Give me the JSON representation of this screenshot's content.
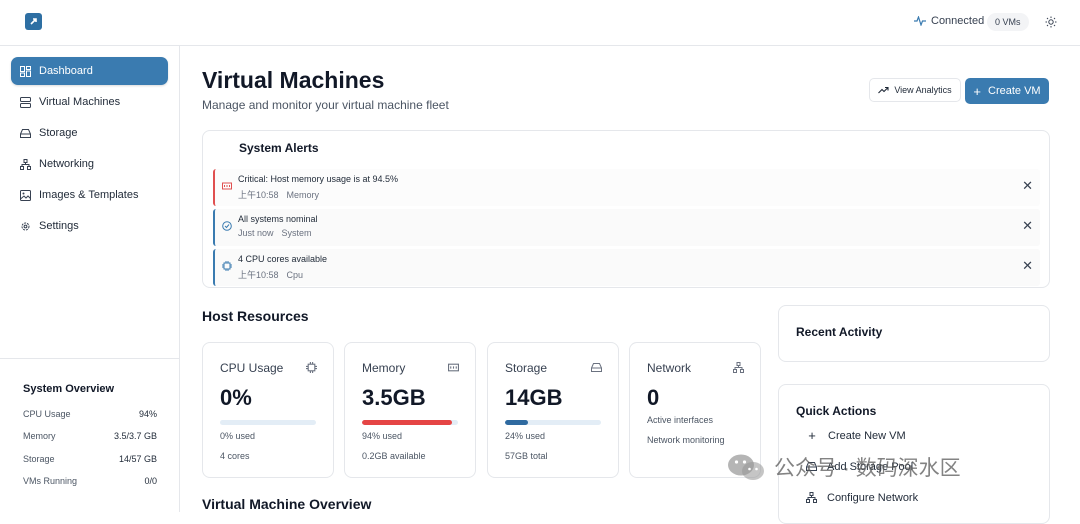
{
  "topbar": {
    "connection_label": "Connected",
    "vms_count": "0 VMs"
  },
  "sidebar": {
    "items": [
      {
        "label": "Dashboard",
        "icon": "dashboard-icon",
        "active": true
      },
      {
        "label": "Virtual Machines",
        "icon": "server-icon"
      },
      {
        "label": "Storage",
        "icon": "hard-drive-icon"
      },
      {
        "label": "Networking",
        "icon": "network-icon"
      },
      {
        "label": "Images & Templates",
        "icon": "image-icon"
      },
      {
        "label": "Settings",
        "icon": "gear-icon"
      }
    ],
    "overview": {
      "title": "System Overview",
      "rows": [
        {
          "label": "CPU Usage",
          "value": "94%"
        },
        {
          "label": "Memory",
          "value": "3.5/3.7 GB"
        },
        {
          "label": "Storage",
          "value": "14/57 GB"
        },
        {
          "label": "VMs Running",
          "value": "0/0"
        }
      ]
    }
  },
  "header": {
    "title": "Virtual Machines",
    "subtitle": "Manage and monitor your virtual machine fleet",
    "analytics_label": "View Analytics",
    "create_label": "Create VM"
  },
  "alerts": {
    "title": "System Alerts",
    "items": [
      {
        "message": "Critical: Host memory usage is at 94.5%",
        "time": "上午10:58",
        "source": "Memory",
        "level": "critical",
        "color": "#e05050"
      },
      {
        "message": "All systems nominal",
        "time": "Just now",
        "source": "System",
        "level": "info",
        "color": "#3a7bb0"
      },
      {
        "message": "4 CPU cores available",
        "time": "上午10:58",
        "source": "Cpu",
        "level": "info",
        "color": "#3a7bb0"
      }
    ]
  },
  "host_resources": {
    "title": "Host Resources",
    "cards": [
      {
        "label": "CPU Usage",
        "value": "0%",
        "progress": 0,
        "bar_color": "#3a7bb0",
        "line1": "0% used",
        "line2": "4 cores",
        "icon": "cpu-icon"
      },
      {
        "label": "Memory",
        "value": "3.5GB",
        "progress": 0.94,
        "bar_color": "#e54545",
        "line1": "94% used",
        "line2": "0.2GB available",
        "icon": "memory-icon"
      },
      {
        "label": "Storage",
        "value": "14GB",
        "progress": 0.24,
        "bar_color": "#2f6aa0",
        "line1": "24% used",
        "line2": "57GB total",
        "icon": "hard-drive-icon"
      },
      {
        "label": "Network",
        "value": "0",
        "line1": "Active interfaces",
        "line2": "Network monitoring",
        "icon": "network-icon"
      }
    ]
  },
  "recent_activity": {
    "title": "Recent Activity"
  },
  "quick_actions": {
    "title": "Quick Actions",
    "items": [
      {
        "label": "Create New VM",
        "icon": "plus-icon"
      },
      {
        "label": "Add Storage Pool",
        "icon": "hard-drive-icon"
      },
      {
        "label": "Configure Network",
        "icon": "network-icon"
      }
    ]
  },
  "vm_overview": {
    "title": "Virtual Machine Overview"
  },
  "watermark": {
    "text": "公众号 · 数码深水区"
  },
  "colors": {
    "accent": "#3a7bb0",
    "critical": "#e05050",
    "memory_bar": "#e54545"
  }
}
